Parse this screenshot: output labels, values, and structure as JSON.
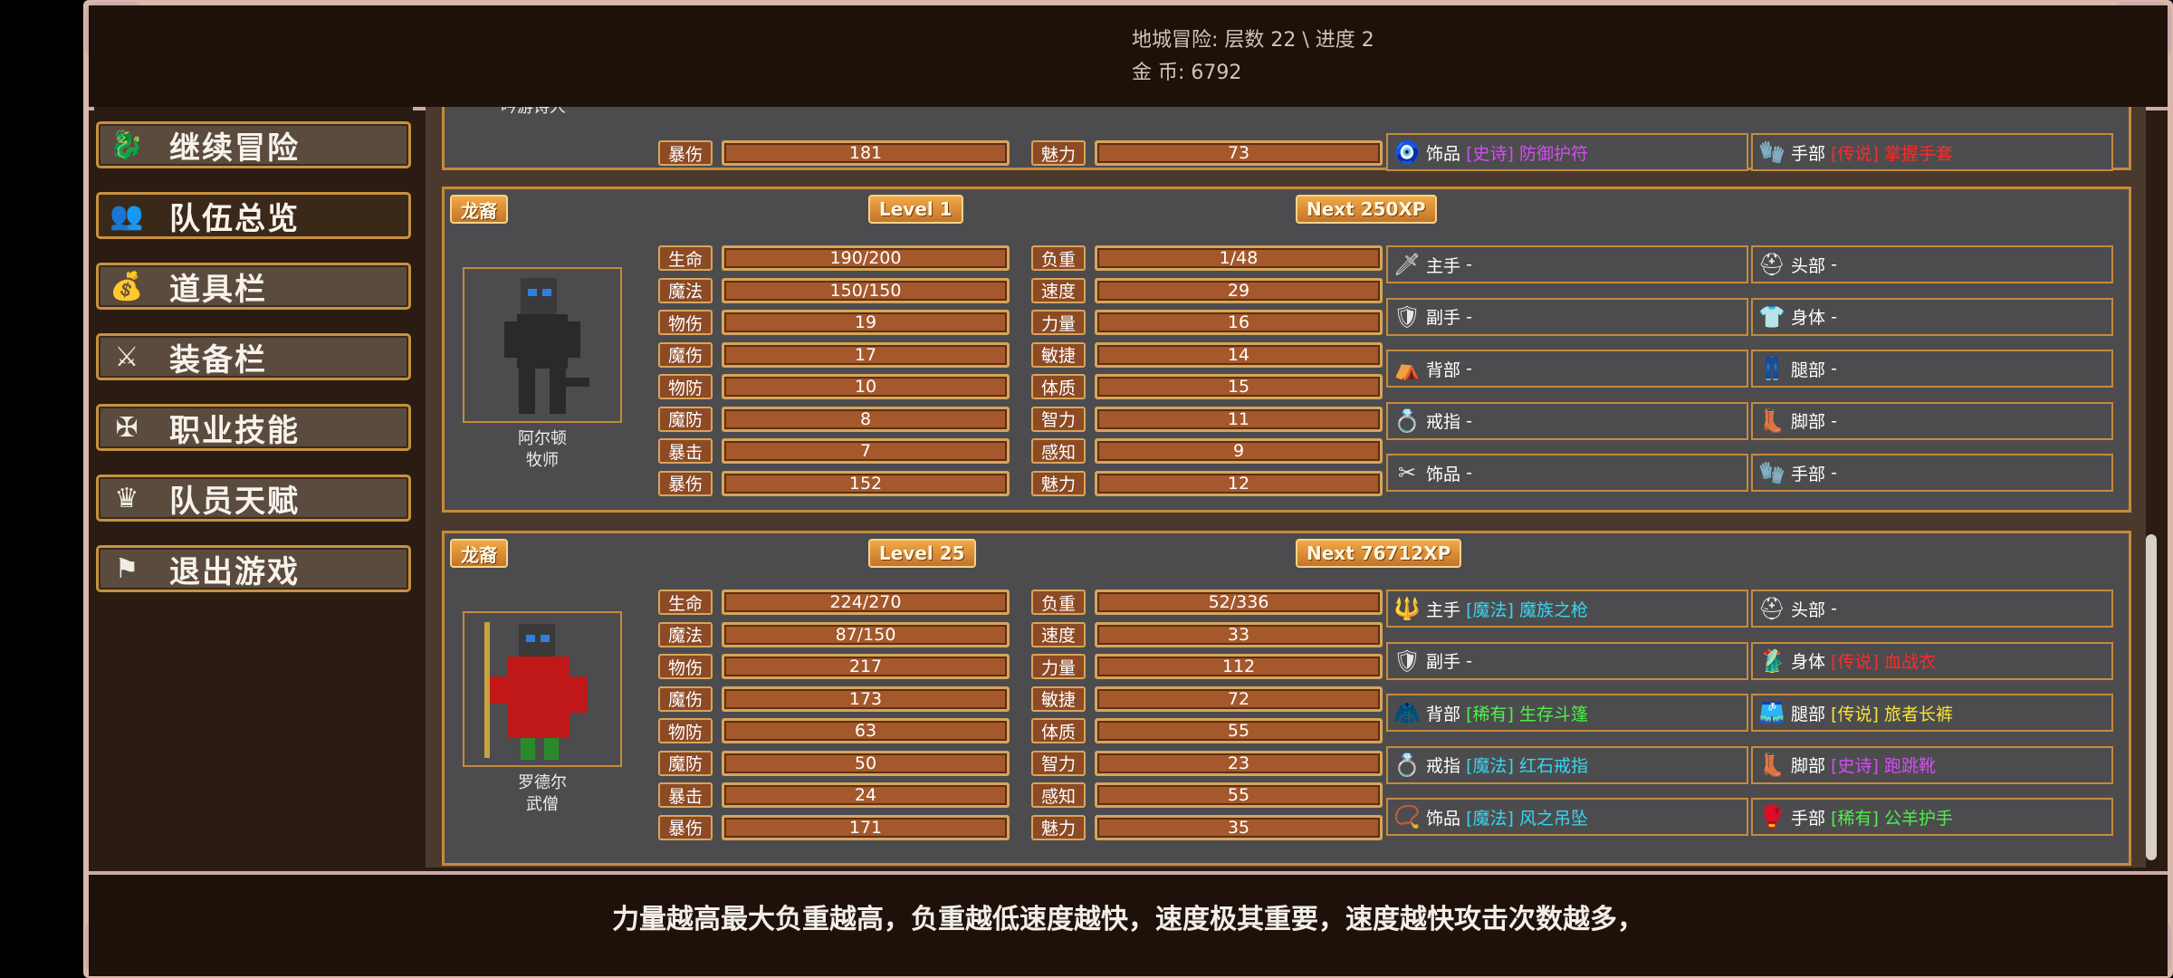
{
  "header": {
    "dungeon_line": "地城冒险: 层数 22 \\ 进度 2",
    "gold_line": "金     币: 6792"
  },
  "menu": [
    {
      "label": "继续冒险",
      "icon": "dragon-icon"
    },
    {
      "label": "队伍总览",
      "icon": "party-icon"
    },
    {
      "label": "道具栏",
      "icon": "bag-icon"
    },
    {
      "label": "装备栏",
      "icon": "equipment-icon"
    },
    {
      "label": "职业技能",
      "icon": "winged-sword-icon"
    },
    {
      "label": "队员天赋",
      "icon": "crown-icon"
    },
    {
      "label": "退出游戏",
      "icon": "exit-flag-icon"
    }
  ],
  "tip": "力量越高最大负重越高，负重越低速度越快，速度极其重要，速度越快攻击次数越多，",
  "partial_member": {
    "name": "吟游诗人",
    "stat_left": {
      "label": "暴伤",
      "value": "181"
    },
    "stat_right": {
      "label": "魅力",
      "value": "73"
    },
    "equip_left": {
      "slot": "饰品",
      "quality": "[史诗]",
      "item": "防御护符"
    },
    "equip_right": {
      "slot": "手部",
      "quality": "[传说]",
      "item": "掌握手套"
    }
  },
  "members": [
    {
      "race": "龙裔",
      "level": "Level 1",
      "next": "Next 250XP",
      "name": "阿尔顿",
      "job": "牧师",
      "stats_left": [
        {
          "label": "生命",
          "value": "190/200"
        },
        {
          "label": "魔法",
          "value": "150/150"
        },
        {
          "label": "物伤",
          "value": "19"
        },
        {
          "label": "魔伤",
          "value": "17"
        },
        {
          "label": "物防",
          "value": "10"
        },
        {
          "label": "魔防",
          "value": "8"
        },
        {
          "label": "暴击",
          "value": "7"
        },
        {
          "label": "暴伤",
          "value": "152"
        }
      ],
      "stats_right": [
        {
          "label": "负重",
          "value": "1/48"
        },
        {
          "label": "速度",
          "value": "29"
        },
        {
          "label": "力量",
          "value": "16"
        },
        {
          "label": "敏捷",
          "value": "14"
        },
        {
          "label": "体质",
          "value": "15"
        },
        {
          "label": "智力",
          "value": "11"
        },
        {
          "label": "感知",
          "value": "9"
        },
        {
          "label": "魅力",
          "value": "12"
        }
      ],
      "equip_left": [
        {
          "slot": "主手",
          "quality": "",
          "item": "-",
          "icon": "sword-icon"
        },
        {
          "slot": "副手",
          "quality": "",
          "item": "-",
          "icon": "shield-icon"
        },
        {
          "slot": "背部",
          "quality": "",
          "item": "-",
          "icon": "cape-icon"
        },
        {
          "slot": "戒指",
          "quality": "",
          "item": "-",
          "icon": "ring-icon"
        },
        {
          "slot": "饰品",
          "quality": "",
          "item": "-",
          "icon": "amulet-icon"
        }
      ],
      "equip_right": [
        {
          "slot": "头部",
          "quality": "",
          "item": "-",
          "icon": "helmet-icon"
        },
        {
          "slot": "身体",
          "quality": "",
          "item": "-",
          "icon": "armor-icon"
        },
        {
          "slot": "腿部",
          "quality": "",
          "item": "-",
          "icon": "legs-icon"
        },
        {
          "slot": "脚部",
          "quality": "",
          "item": "-",
          "icon": "boots-icon"
        },
        {
          "slot": "手部",
          "quality": "",
          "item": "-",
          "icon": "gloves-icon"
        }
      ]
    },
    {
      "race": "龙裔",
      "level": "Level 25",
      "next": "Next 76712XP",
      "name": "罗德尔",
      "job": "武僧",
      "stats_left": [
        {
          "label": "生命",
          "value": "224/270"
        },
        {
          "label": "魔法",
          "value": "87/150"
        },
        {
          "label": "物伤",
          "value": "217"
        },
        {
          "label": "魔伤",
          "value": "173"
        },
        {
          "label": "物防",
          "value": "63"
        },
        {
          "label": "魔防",
          "value": "50"
        },
        {
          "label": "暴击",
          "value": "24"
        },
        {
          "label": "暴伤",
          "value": "171"
        }
      ],
      "stats_right": [
        {
          "label": "负重",
          "value": "52/336"
        },
        {
          "label": "速度",
          "value": "33"
        },
        {
          "label": "力量",
          "value": "112"
        },
        {
          "label": "敏捷",
          "value": "72"
        },
        {
          "label": "体质",
          "value": "55"
        },
        {
          "label": "智力",
          "value": "23"
        },
        {
          "label": "感知",
          "value": "55"
        },
        {
          "label": "魅力",
          "value": "35"
        }
      ],
      "equip_left": [
        {
          "slot": "主手",
          "quality": "[魔法]",
          "item": "魔族之枪",
          "icon": "spear-icon",
          "q": "q-magic"
        },
        {
          "slot": "副手",
          "quality": "",
          "item": "-",
          "icon": "shield-icon",
          "q": ""
        },
        {
          "slot": "背部",
          "quality": "[稀有]",
          "item": "生存斗篷",
          "icon": "cloak-icon",
          "q": "q-rare"
        },
        {
          "slot": "戒指",
          "quality": "[魔法]",
          "item": "红石戒指",
          "icon": "ring-icon",
          "q": "q-magic"
        },
        {
          "slot": "饰品",
          "quality": "[魔法]",
          "item": "风之吊坠",
          "icon": "pendant-icon",
          "q": "q-magic"
        }
      ],
      "equip_right": [
        {
          "slot": "头部",
          "quality": "",
          "item": "-",
          "icon": "helmet-icon",
          "q": ""
        },
        {
          "slot": "身体",
          "quality": "[传说]",
          "item": "血战衣",
          "icon": "robe-icon",
          "q": "q-legend"
        },
        {
          "slot": "腿部",
          "quality": "[传说]",
          "item": "旅者长裤",
          "icon": "pants-icon",
          "q": "q-legend2"
        },
        {
          "slot": "脚部",
          "quality": "[史诗]",
          "item": "跑跳靴",
          "icon": "boots-icon",
          "q": "q-epic"
        },
        {
          "slot": "手部",
          "quality": "[稀有]",
          "item": "公羊护手",
          "icon": "gauntlet-icon",
          "q": "q-rare"
        }
      ]
    }
  ]
}
